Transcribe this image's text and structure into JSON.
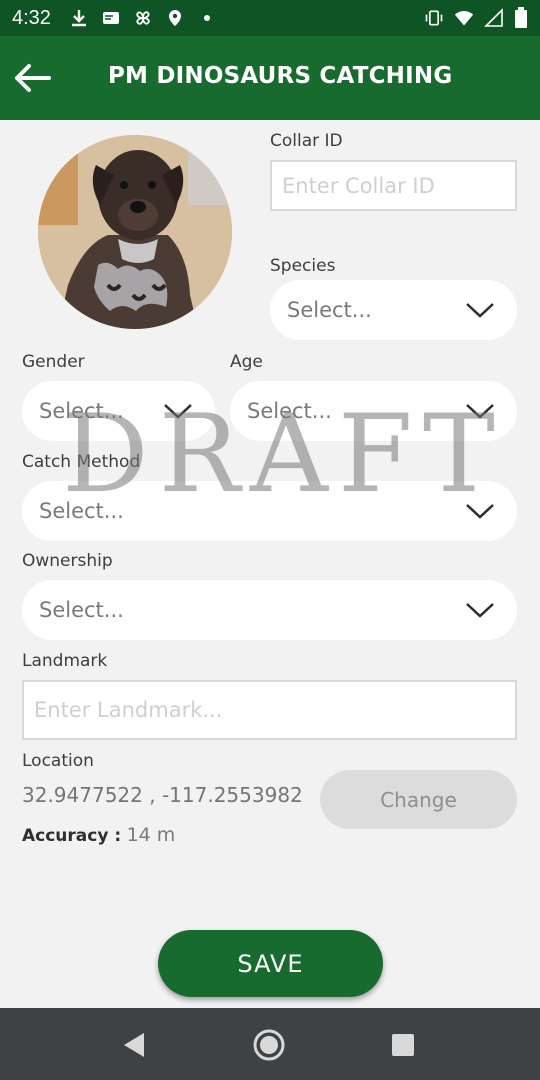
{
  "status_bar": {
    "time": "4:32",
    "icons_left": [
      "download-icon",
      "message-icon",
      "pinwheel-icon",
      "location-pin-icon",
      "dot-icon"
    ],
    "icons_right": [
      "vibrate-icon",
      "wifi-icon",
      "signal-icon",
      "battery-icon"
    ]
  },
  "app_bar": {
    "title": "PM DINOSAURS CATCHING",
    "back_icon": "arrow-left-icon",
    "color": "#186b2e"
  },
  "form": {
    "collar_id": {
      "label": "Collar ID",
      "placeholder": "Enter Collar ID",
      "value": ""
    },
    "species": {
      "label": "Species",
      "value": "Select..."
    },
    "gender": {
      "label": "Gender",
      "value": "Select..."
    },
    "age": {
      "label": "Age",
      "value": "Select..."
    },
    "catch_method": {
      "label": "Catch Method",
      "value": "Select..."
    },
    "ownership": {
      "label": "Ownership",
      "value": "Select..."
    },
    "landmark": {
      "label": "Landmark",
      "placeholder": "Enter Landmark...",
      "value": ""
    },
    "location": {
      "label": "Location",
      "value": "32.9477522 , -117.2553982",
      "change_label": "Change"
    },
    "accuracy": {
      "label": "Accuracy :",
      "value": "14 m"
    }
  },
  "save_label": "SAVE",
  "watermark": "DRAFT",
  "nav_bar": {
    "icons": [
      "back-triangle-icon",
      "home-circle-icon",
      "recents-square-icon"
    ]
  },
  "colors": {
    "primary": "#186b2e",
    "status_bar": "#0f5424",
    "background": "#f3f2f2"
  }
}
